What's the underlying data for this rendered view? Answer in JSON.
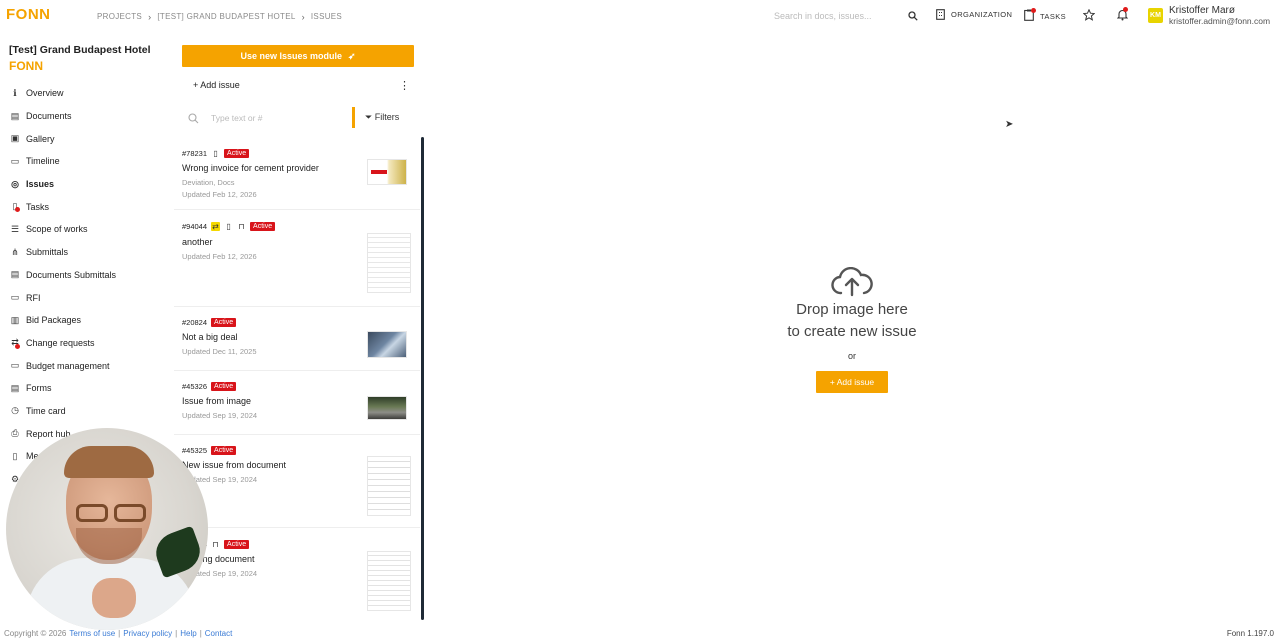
{
  "app": {
    "logo": "FONN"
  },
  "breadcrumb": [
    "PROJECTS",
    "[TEST] GRAND BUDAPEST HOTEL",
    "ISSUES"
  ],
  "search": {
    "placeholder": "Search in docs, issues..."
  },
  "topnav": {
    "organization": "ORGANIZATION",
    "tasks": "TASKS"
  },
  "user": {
    "initials": "KM",
    "name": "Kristoffer Marø",
    "email": "kristoffer.admin@fonn.com"
  },
  "sidebar": {
    "project_title": "[Test] Grand Budapest Hotel",
    "project_logo": "FONN",
    "items": [
      {
        "label": "Overview",
        "icon": "info-icon"
      },
      {
        "label": "Documents",
        "icon": "document-icon"
      },
      {
        "label": "Gallery",
        "icon": "gallery-icon"
      },
      {
        "label": "Timeline",
        "icon": "timeline-icon"
      },
      {
        "label": "Issues",
        "icon": "issues-icon",
        "active": true
      },
      {
        "label": "Tasks",
        "icon": "tasks-icon"
      },
      {
        "label": "Scope of works",
        "icon": "list-icon"
      },
      {
        "label": "Submittals",
        "icon": "submittals-icon"
      },
      {
        "label": "Documents Submittals",
        "icon": "document-icon"
      },
      {
        "label": "RFI",
        "icon": "rfi-icon"
      },
      {
        "label": "Bid Packages",
        "icon": "package-icon"
      },
      {
        "label": "Change requests",
        "icon": "change-icon"
      },
      {
        "label": "Budget management",
        "icon": "budget-icon"
      },
      {
        "label": "Forms",
        "icon": "forms-icon"
      },
      {
        "label": "Time card",
        "icon": "clock-icon"
      },
      {
        "label": "Report hub",
        "icon": "print-icon"
      },
      {
        "label": "Me",
        "icon": "members-icon"
      }
    ]
  },
  "issues_panel": {
    "new_module_label": "Use new Issues module",
    "add_issue_label": "+ Add issue",
    "search_placeholder": "Type text or #",
    "filters_label": "Filters",
    "issues": [
      {
        "id": "#78231",
        "status": "Active",
        "title": "Wrong invoice for cement provider",
        "tags": "Deviation, Docs",
        "updated": "Updated Feb 12, 2026"
      },
      {
        "id": "#94044",
        "status": "Active",
        "title": "another",
        "tags": "",
        "updated": "Updated Feb 12, 2026"
      },
      {
        "id": "#20824",
        "status": "Active",
        "title": "Not a big deal",
        "tags": "",
        "updated": "Updated Dec 11, 2025"
      },
      {
        "id": "#45326",
        "status": "Active",
        "title": "Issue from image",
        "tags": "",
        "updated": "Updated Sep 19, 2024"
      },
      {
        "id": "#45325",
        "status": "Active",
        "title": "New issue from document",
        "tags": "",
        "updated": "Updated Sep 19, 2024"
      },
      {
        "id": "#45324",
        "status": "Active",
        "title": "Missing document",
        "tags": "",
        "updated": "Updated Sep 19, 2024"
      }
    ]
  },
  "dropzone": {
    "line1": "Drop image here",
    "line2": "to create new issue",
    "or": "or",
    "add_label": "+ Add issue"
  },
  "footer": {
    "copyright": "Copyright © 2026",
    "terms": "Terms of use",
    "privacy": "Privacy policy",
    "help": "Help",
    "contact": "Contact",
    "version": "Fonn 1.197.0"
  },
  "colors": {
    "accent": "#f5a300",
    "badge": "#d8141a",
    "scrollbar": "#1f2a36"
  }
}
